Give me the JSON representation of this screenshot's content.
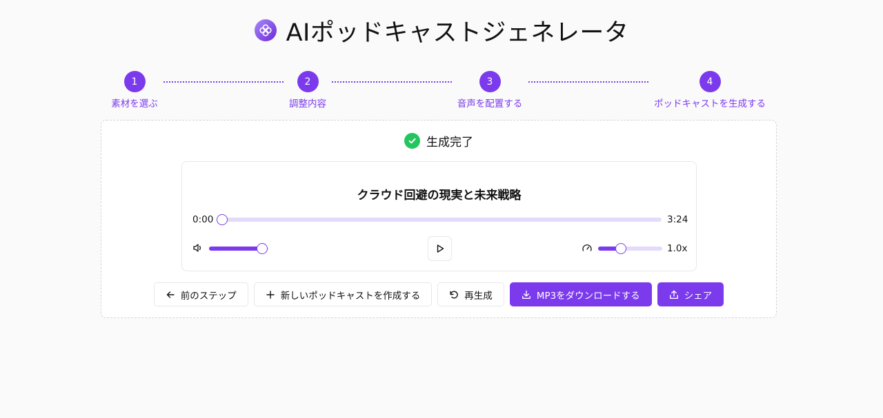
{
  "app": {
    "title": "AIポッドキャストジェネレータ",
    "logo_icon": "flower-logo-icon"
  },
  "stepper": {
    "steps": [
      {
        "number": "1",
        "label": "素材を選ぶ"
      },
      {
        "number": "2",
        "label": "調整内容"
      },
      {
        "number": "3",
        "label": "音声を配置する"
      },
      {
        "number": "4",
        "label": "ポッドキャストを生成する"
      }
    ]
  },
  "status": {
    "text": "生成完了",
    "icon": "check-circle-icon"
  },
  "player": {
    "title": "クラウド回避の現実と未来戦略",
    "current_time": "0:00",
    "duration": "3:24",
    "progress": 0,
    "volume": 0.9,
    "speed_label": "1.0x",
    "speed_level": 0.36
  },
  "actions": {
    "back_label": "前のステップ",
    "new_label": "新しいポッドキャストを作成する",
    "regenerate_label": "再生成",
    "download_label": "MP3をダウンロードする",
    "share_label": "シェア"
  },
  "colors": {
    "accent": "#7c3aed",
    "accent_light": "#e4dbfb",
    "success": "#22c55e",
    "background": "#fafafa"
  }
}
